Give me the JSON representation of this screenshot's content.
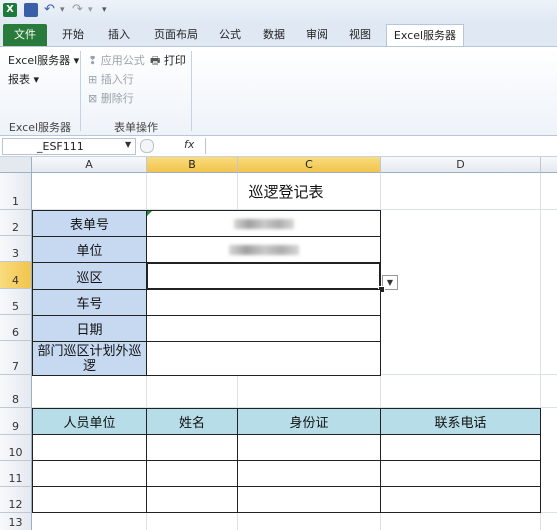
{
  "qat": {
    "undo": "↶",
    "redo": "↷",
    "dropdown": "▾"
  },
  "tabs": {
    "file": "文件",
    "home": "开始",
    "insert": "插入",
    "layout": "页面布局",
    "formulas": "公式",
    "data": "数据",
    "review": "审阅",
    "view": "视图",
    "excel_server": "Excel服务器"
  },
  "ribbon": {
    "excel_server_btn": "Excel服务器 ▾",
    "report_btn": "报表 ▾",
    "apply_formula": "应用公式",
    "print": "打印",
    "insert_row": "插入行",
    "delete_row": "删除行",
    "group1": "Excel服务器",
    "group2": "表单操作"
  },
  "formula_bar": {
    "name_box": "_ESF111",
    "fx": "fx",
    "value": ""
  },
  "columns": [
    "A",
    "B",
    "C",
    "D"
  ],
  "rows": [
    "1",
    "2",
    "3",
    "4",
    "5",
    "6",
    "7",
    "8",
    "9",
    "10",
    "11",
    "12",
    "13"
  ],
  "sheet": {
    "title": "巡逻登记表",
    "labels": [
      "表单号",
      "单位",
      "巡区",
      "车号",
      "日期",
      "部门巡区计划外巡逻"
    ],
    "table_headers": [
      "人员单位",
      "姓名",
      "身份证",
      "联系电话"
    ]
  }
}
